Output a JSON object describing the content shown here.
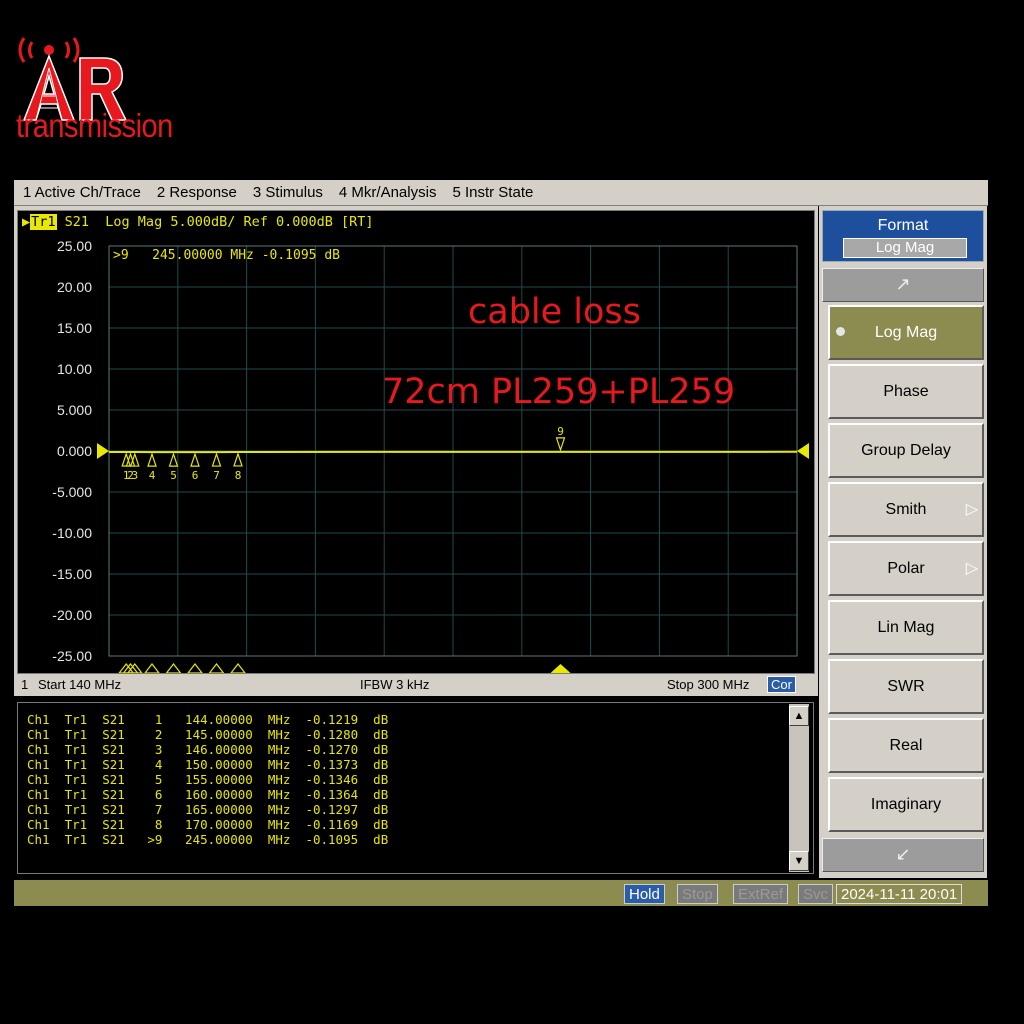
{
  "logo": {
    "letters": "AR",
    "subtitle": "transmission"
  },
  "menu": [
    "1 Active Ch/Trace",
    "2 Response",
    "3 Stimulus",
    "4 Mkr/Analysis",
    "5 Instr State"
  ],
  "trace": {
    "tr_label": "Tr1",
    "title_rest": " S21  Log Mag 5.000dB/ Ref 0.000dB [RT]",
    "active_marker": ">9   245.00000 MHz -0.1095 dB",
    "color": "#e8e800"
  },
  "annotations": {
    "line1": "cable loss",
    "line2": "72cm PL259+PL259",
    "color": "#e8191e"
  },
  "status": {
    "channel": "1",
    "start": "Start 140 MHz",
    "ifbw": "IFBW 3 kHz",
    "stop": "Stop 300 MHz",
    "cor": "Cor"
  },
  "chart_data": {
    "type": "line",
    "xlim": [
      140,
      300
    ],
    "ylim": [
      -25,
      25
    ],
    "x_unit": "MHz",
    "y_unit": "dB",
    "ytick_labels": [
      "25.00",
      "20.00",
      "15.00",
      "10.00",
      "5.000",
      "0.000",
      "-5.000",
      "-10.00",
      "-15.00",
      "-20.00",
      "-25.00"
    ],
    "grid": true,
    "series": [
      {
        "x": [
          140,
          144,
          145,
          146,
          150,
          155,
          160,
          165,
          170,
          200,
          245,
          300
        ],
        "y": [
          -0.12,
          -0.1219,
          -0.128,
          -0.127,
          -0.1373,
          -0.1346,
          -0.1364,
          -0.1297,
          -0.1169,
          -0.11,
          -0.1095,
          -0.1
        ]
      }
    ],
    "markers": [
      {
        "n": "1",
        "x": 144,
        "y": -0.1219
      },
      {
        "n": "2",
        "x": 145,
        "y": -0.128
      },
      {
        "n": "3",
        "x": 146,
        "y": -0.127
      },
      {
        "n": "4",
        "x": 150,
        "y": -0.1373
      },
      {
        "n": "5",
        "x": 155,
        "y": -0.1346
      },
      {
        "n": "6",
        "x": 160,
        "y": -0.1364
      },
      {
        "n": "7",
        "x": 165,
        "y": -0.1297
      },
      {
        "n": "8",
        "x": 170,
        "y": -0.1169
      },
      {
        "n": "9",
        "x": 245,
        "y": -0.1095
      }
    ]
  },
  "marker_table": [
    "Ch1  Tr1  S21    1   144.00000  MHz  -0.1219  dB",
    "Ch1  Tr1  S21    2   145.00000  MHz  -0.1280  dB",
    "Ch1  Tr1  S21    3   146.00000  MHz  -0.1270  dB",
    "Ch1  Tr1  S21    4   150.00000  MHz  -0.1373  dB",
    "Ch1  Tr1  S21    5   155.00000  MHz  -0.1346  dB",
    "Ch1  Tr1  S21    6   160.00000  MHz  -0.1364  dB",
    "Ch1  Tr1  S21    7   165.00000  MHz  -0.1297  dB",
    "Ch1  Tr1  S21    8   170.00000  MHz  -0.1169  dB",
    "Ch1  Tr1  S21   >9   245.00000  MHz  -0.1095  dB"
  ],
  "softkeys": {
    "header": "Format",
    "header_value": "Log Mag",
    "items": [
      {
        "label": "Log Mag",
        "active": true,
        "submenu": false
      },
      {
        "label": "Phase",
        "active": false,
        "submenu": false
      },
      {
        "label": "Group Delay",
        "active": false,
        "submenu": false
      },
      {
        "label": "Smith",
        "active": false,
        "submenu": true
      },
      {
        "label": "Polar",
        "active": false,
        "submenu": true
      },
      {
        "label": "Lin Mag",
        "active": false,
        "submenu": false
      },
      {
        "label": "SWR",
        "active": false,
        "submenu": false
      },
      {
        "label": "Real",
        "active": false,
        "submenu": false
      },
      {
        "label": "Imaginary",
        "active": false,
        "submenu": false
      }
    ]
  },
  "bottom": {
    "hold": "Hold",
    "stop": "Stop",
    "extref": "ExtRef",
    "svc": "Svc",
    "datetime": "2024-11-11 20:01"
  }
}
